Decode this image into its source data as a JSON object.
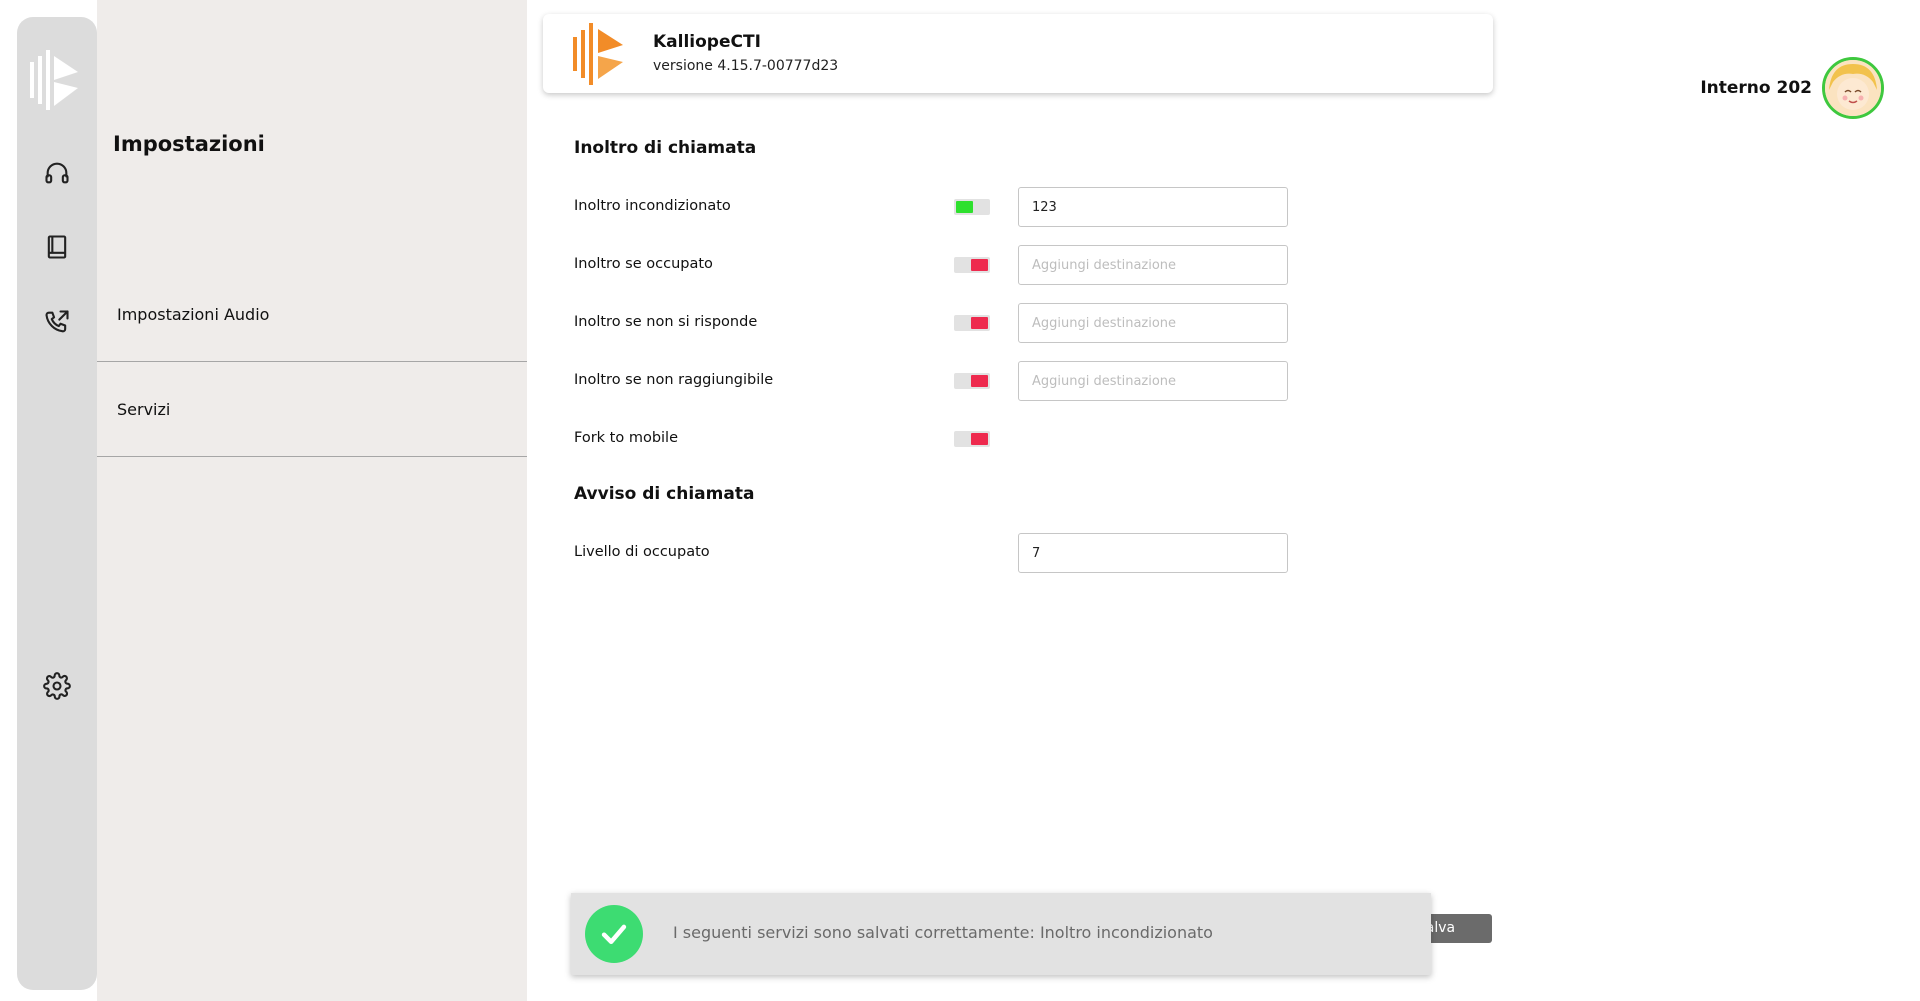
{
  "brand": {
    "accent_orange": "#f28c28",
    "toggle_on": "#2ee02e",
    "toggle_off": "#ee2a4e",
    "toast_check": "#3ddc72"
  },
  "rail": {
    "items": [
      {
        "icon": "headset-icon"
      },
      {
        "icon": "book-icon"
      },
      {
        "icon": "phone-forward-icon"
      },
      {
        "icon": "gear-icon"
      }
    ]
  },
  "panel": {
    "title": "Impostazioni",
    "menu": [
      {
        "label": "Impostazioni Audio"
      },
      {
        "label": "Servizi"
      }
    ]
  },
  "app": {
    "name": "KalliopeCTI",
    "version": "versione 4.15.7-00777d23"
  },
  "user": {
    "name": "Interno 202"
  },
  "forwarding": {
    "title": "Inoltro di chiamata",
    "rows": [
      {
        "label": "Inoltro incondizionato",
        "enabled": true,
        "value": "123",
        "placeholder": "Aggiungi destinazione"
      },
      {
        "label": "Inoltro se occupato",
        "enabled": false,
        "value": "",
        "placeholder": "Aggiungi destinazione"
      },
      {
        "label": "Inoltro se non si risponde",
        "enabled": false,
        "value": "",
        "placeholder": "Aggiungi destinazione"
      },
      {
        "label": "Inoltro se non raggiungibile",
        "enabled": false,
        "value": "",
        "placeholder": "Aggiungi destinazione"
      },
      {
        "label": "Fork to mobile",
        "enabled": false
      }
    ]
  },
  "call_waiting": {
    "title": "Avviso di chiamata",
    "label": "Livello di occupato",
    "value": "7"
  },
  "save_button": {
    "label": "Salva"
  },
  "toast": {
    "message": "I seguenti servizi sono salvati correttamente: Inoltro incondizionato"
  }
}
